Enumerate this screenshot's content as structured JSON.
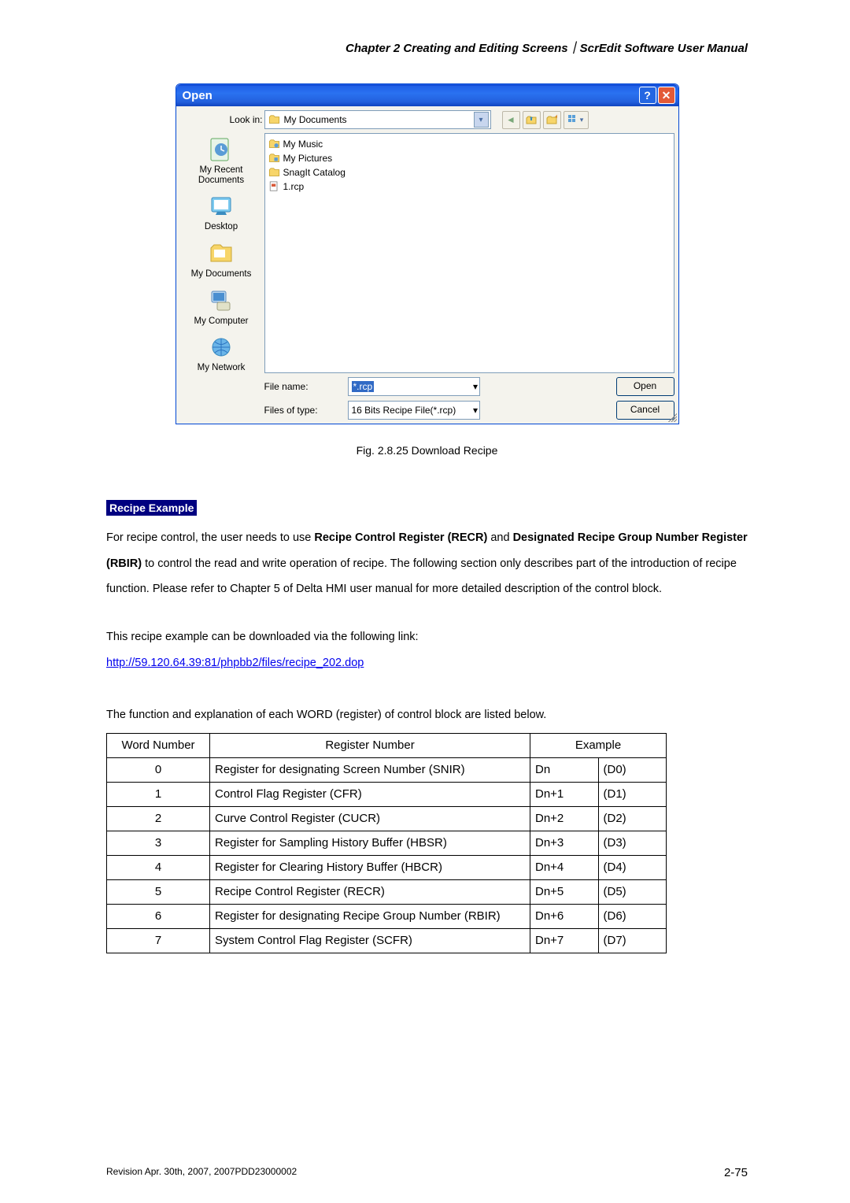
{
  "header": "Chapter 2  Creating and Editing Screens｜ScrEdit Software User Manual",
  "dialog": {
    "title": "Open",
    "lookin_label": "Look in:",
    "lookin_value": "My Documents",
    "places": [
      "My Recent Documents",
      "Desktop",
      "My Documents",
      "My Computer",
      "My Network"
    ],
    "files": [
      "My Music",
      "My Pictures",
      "SnagIt Catalog",
      "1.rcp"
    ],
    "filename_label": "File name:",
    "filename_value": "*.rcp",
    "filetype_label": "Files of type:",
    "filetype_value": "16 Bits Recipe File(*.rcp)",
    "open_btn": "Open",
    "cancel_btn": "Cancel"
  },
  "fig_caption": "Fig. 2.8.25 Download Recipe",
  "subhead": "Recipe Example",
  "para1_a": "For recipe control, the user needs to use ",
  "b1": "Recipe Control Register (RECR)",
  "and": " and ",
  "b2": "Designated Recipe Group Number Register (RBIR)",
  "para1_b": " to control the read and write operation of recipe. The following section only describes part of the introduction of recipe function. Please refer to Chapter 5 of Delta HMI user manual for more detailed description of the control block.",
  "para2": "This recipe example can be downloaded via the following link:",
  "link": "http://59.120.64.39:81/phpbb2/files/recipe_202.dop",
  "para3": "The function and explanation of each WORD (register) of control block are listed below.",
  "thead": {
    "c1": "Word Number",
    "c2": "Register Number",
    "c3": "Example"
  },
  "rows": [
    {
      "w": "0",
      "r": "Register for designating Screen Number (SNIR)",
      "e1": "Dn",
      "e2": "(D0)"
    },
    {
      "w": "1",
      "r": "Control Flag Register (CFR)",
      "e1": "Dn+1",
      "e2": "(D1)"
    },
    {
      "w": "2",
      "r": "Curve Control Register (CUCR)",
      "e1": "Dn+2",
      "e2": "(D2)"
    },
    {
      "w": "3",
      "r": "Register for Sampling History Buffer (HBSR)",
      "e1": "Dn+3",
      "e2": "(D3)"
    },
    {
      "w": "4",
      "r": "Register for Clearing History Buffer (HBCR)",
      "e1": "Dn+4",
      "e2": "(D4)"
    },
    {
      "w": "5",
      "r": "Recipe Control Register (RECR)",
      "e1": "Dn+5",
      "e2": "(D5)"
    },
    {
      "w": "6",
      "r": "Register for designating Recipe Group Number (RBIR)",
      "e1": "Dn+6",
      "e2": "(D6)"
    },
    {
      "w": "7",
      "r": "System Control Flag Register (SCFR)",
      "e1": "Dn+7",
      "e2": "(D7)"
    }
  ],
  "footer_left": "Revision Apr. 30th, 2007, 2007PDD23000002",
  "footer_right": "2-75"
}
